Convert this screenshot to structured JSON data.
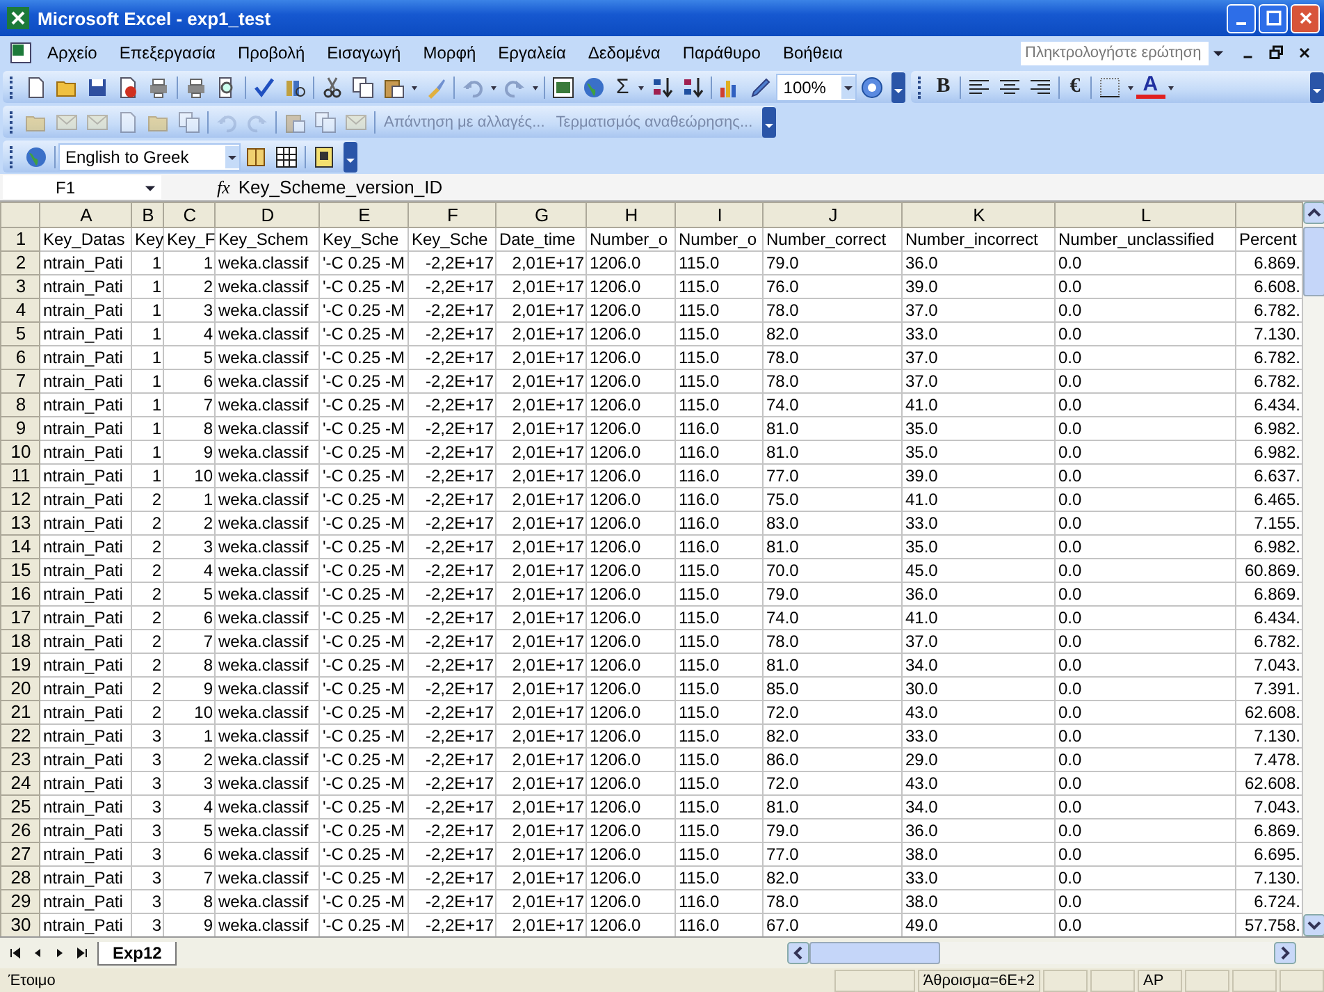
{
  "window": {
    "title": "Microsoft Excel - exp1_test"
  },
  "menu": [
    "Αρχείο",
    "Επεξεργασία",
    "Προβολή",
    "Εισαγωγή",
    "Μορφή",
    "Εργαλεία",
    "Δεδομένα",
    "Παράθυρο",
    "Βοήθεια"
  ],
  "help_box": {
    "placeholder": "Πληκτρολογήστε ερώτηση"
  },
  "standard_toolbar": {
    "autosum": "Σ",
    "zoom": "100%"
  },
  "formatting_toolbar": {
    "bold": "B",
    "currency": "€",
    "font_color": "A"
  },
  "reviewing_toolbar": {
    "disabled": true,
    "reply_with_changes": "Απάντηση με αλλαγές...",
    "end_review": "Τερματισμός αναθεώρησης..."
  },
  "translate_toolbar": {
    "language": "English to Greek"
  },
  "formula_bar": {
    "name_box": "F1",
    "fx": "fx",
    "formula": "Key_Scheme_version_ID"
  },
  "sheet": {
    "columns": [
      "A",
      "B",
      "C",
      "D",
      "E",
      "F",
      "G",
      "H",
      "I",
      "J",
      "K",
      "L"
    ],
    "rows": [
      {
        "number": "1",
        "cells": [
          "Key_Datas",
          "Key",
          "Key_F",
          "Key_Schem",
          "Key_Sche",
          "Key_Sche",
          "Date_time",
          "Number_o",
          "Number_o",
          "Number_correct",
          "Number_incorrect",
          "Number_unclassified",
          "Percent"
        ]
      },
      {
        "number": "2",
        "cells": [
          "ntrain_Pati",
          "1",
          "1",
          "weka.classif",
          "'-C 0.25 -M",
          "-2,2E+17",
          "2,01E+17",
          "1206.0",
          "115.0",
          "79.0",
          "36.0",
          "0.0",
          "6.869."
        ]
      },
      {
        "number": "3",
        "cells": [
          "ntrain_Pati",
          "1",
          "2",
          "weka.classif",
          "'-C 0.25 -M",
          "-2,2E+17",
          "2,01E+17",
          "1206.0",
          "115.0",
          "76.0",
          "39.0",
          "0.0",
          "6.608."
        ]
      },
      {
        "number": "4",
        "cells": [
          "ntrain_Pati",
          "1",
          "3",
          "weka.classif",
          "'-C 0.25 -M",
          "-2,2E+17",
          "2,01E+17",
          "1206.0",
          "115.0",
          "78.0",
          "37.0",
          "0.0",
          "6.782."
        ]
      },
      {
        "number": "5",
        "cells": [
          "ntrain_Pati",
          "1",
          "4",
          "weka.classif",
          "'-C 0.25 -M",
          "-2,2E+17",
          "2,01E+17",
          "1206.0",
          "115.0",
          "82.0",
          "33.0",
          "0.0",
          "7.130."
        ]
      },
      {
        "number": "6",
        "cells": [
          "ntrain_Pati",
          "1",
          "5",
          "weka.classif",
          "'-C 0.25 -M",
          "-2,2E+17",
          "2,01E+17",
          "1206.0",
          "115.0",
          "78.0",
          "37.0",
          "0.0",
          "6.782."
        ]
      },
      {
        "number": "7",
        "cells": [
          "ntrain_Pati",
          "1",
          "6",
          "weka.classif",
          "'-C 0.25 -M",
          "-2,2E+17",
          "2,01E+17",
          "1206.0",
          "115.0",
          "78.0",
          "37.0",
          "0.0",
          "6.782."
        ]
      },
      {
        "number": "8",
        "cells": [
          "ntrain_Pati",
          "1",
          "7",
          "weka.classif",
          "'-C 0.25 -M",
          "-2,2E+17",
          "2,01E+17",
          "1206.0",
          "115.0",
          "74.0",
          "41.0",
          "0.0",
          "6.434."
        ]
      },
      {
        "number": "9",
        "cells": [
          "ntrain_Pati",
          "1",
          "8",
          "weka.classif",
          "'-C 0.25 -M",
          "-2,2E+17",
          "2,01E+17",
          "1206.0",
          "116.0",
          "81.0",
          "35.0",
          "0.0",
          "6.982."
        ]
      },
      {
        "number": "10",
        "cells": [
          "ntrain_Pati",
          "1",
          "9",
          "weka.classif",
          "'-C 0.25 -M",
          "-2,2E+17",
          "2,01E+17",
          "1206.0",
          "116.0",
          "81.0",
          "35.0",
          "0.0",
          "6.982."
        ]
      },
      {
        "number": "11",
        "cells": [
          "ntrain_Pati",
          "1",
          "10",
          "weka.classif",
          "'-C 0.25 -M",
          "-2,2E+17",
          "2,01E+17",
          "1206.0",
          "116.0",
          "77.0",
          "39.0",
          "0.0",
          "6.637."
        ]
      },
      {
        "number": "12",
        "cells": [
          "ntrain_Pati",
          "2",
          "1",
          "weka.classif",
          "'-C 0.25 -M",
          "-2,2E+17",
          "2,01E+17",
          "1206.0",
          "116.0",
          "75.0",
          "41.0",
          "0.0",
          "6.465."
        ]
      },
      {
        "number": "13",
        "cells": [
          "ntrain_Pati",
          "2",
          "2",
          "weka.classif",
          "'-C 0.25 -M",
          "-2,2E+17",
          "2,01E+17",
          "1206.0",
          "116.0",
          "83.0",
          "33.0",
          "0.0",
          "7.155."
        ]
      },
      {
        "number": "14",
        "cells": [
          "ntrain_Pati",
          "2",
          "3",
          "weka.classif",
          "'-C 0.25 -M",
          "-2,2E+17",
          "2,01E+17",
          "1206.0",
          "116.0",
          "81.0",
          "35.0",
          "0.0",
          "6.982."
        ]
      },
      {
        "number": "15",
        "cells": [
          "ntrain_Pati",
          "2",
          "4",
          "weka.classif",
          "'-C 0.25 -M",
          "-2,2E+17",
          "2,01E+17",
          "1206.0",
          "115.0",
          "70.0",
          "45.0",
          "0.0",
          "60.869."
        ]
      },
      {
        "number": "16",
        "cells": [
          "ntrain_Pati",
          "2",
          "5",
          "weka.classif",
          "'-C 0.25 -M",
          "-2,2E+17",
          "2,01E+17",
          "1206.0",
          "115.0",
          "79.0",
          "36.0",
          "0.0",
          "6.869."
        ]
      },
      {
        "number": "17",
        "cells": [
          "ntrain_Pati",
          "2",
          "6",
          "weka.classif",
          "'-C 0.25 -M",
          "-2,2E+17",
          "2,01E+17",
          "1206.0",
          "115.0",
          "74.0",
          "41.0",
          "0.0",
          "6.434."
        ]
      },
      {
        "number": "18",
        "cells": [
          "ntrain_Pati",
          "2",
          "7",
          "weka.classif",
          "'-C 0.25 -M",
          "-2,2E+17",
          "2,01E+17",
          "1206.0",
          "115.0",
          "78.0",
          "37.0",
          "0.0",
          "6.782."
        ]
      },
      {
        "number": "19",
        "cells": [
          "ntrain_Pati",
          "2",
          "8",
          "weka.classif",
          "'-C 0.25 -M",
          "-2,2E+17",
          "2,01E+17",
          "1206.0",
          "115.0",
          "81.0",
          "34.0",
          "0.0",
          "7.043."
        ]
      },
      {
        "number": "20",
        "cells": [
          "ntrain_Pati",
          "2",
          "9",
          "weka.classif",
          "'-C 0.25 -M",
          "-2,2E+17",
          "2,01E+17",
          "1206.0",
          "115.0",
          "85.0",
          "30.0",
          "0.0",
          "7.391."
        ]
      },
      {
        "number": "21",
        "cells": [
          "ntrain_Pati",
          "2",
          "10",
          "weka.classif",
          "'-C 0.25 -M",
          "-2,2E+17",
          "2,01E+17",
          "1206.0",
          "115.0",
          "72.0",
          "43.0",
          "0.0",
          "62.608."
        ]
      },
      {
        "number": "22",
        "cells": [
          "ntrain_Pati",
          "3",
          "1",
          "weka.classif",
          "'-C 0.25 -M",
          "-2,2E+17",
          "2,01E+17",
          "1206.0",
          "115.0",
          "82.0",
          "33.0",
          "0.0",
          "7.130."
        ]
      },
      {
        "number": "23",
        "cells": [
          "ntrain_Pati",
          "3",
          "2",
          "weka.classif",
          "'-C 0.25 -M",
          "-2,2E+17",
          "2,01E+17",
          "1206.0",
          "115.0",
          "86.0",
          "29.0",
          "0.0",
          "7.478."
        ]
      },
      {
        "number": "24",
        "cells": [
          "ntrain_Pati",
          "3",
          "3",
          "weka.classif",
          "'-C 0.25 -M",
          "-2,2E+17",
          "2,01E+17",
          "1206.0",
          "115.0",
          "72.0",
          "43.0",
          "0.0",
          "62.608."
        ]
      },
      {
        "number": "25",
        "cells": [
          "ntrain_Pati",
          "3",
          "4",
          "weka.classif",
          "'-C 0.25 -M",
          "-2,2E+17",
          "2,01E+17",
          "1206.0",
          "115.0",
          "81.0",
          "34.0",
          "0.0",
          "7.043."
        ]
      },
      {
        "number": "26",
        "cells": [
          "ntrain_Pati",
          "3",
          "5",
          "weka.classif",
          "'-C 0.25 -M",
          "-2,2E+17",
          "2,01E+17",
          "1206.0",
          "115.0",
          "79.0",
          "36.0",
          "0.0",
          "6.869."
        ]
      },
      {
        "number": "27",
        "cells": [
          "ntrain_Pati",
          "3",
          "6",
          "weka.classif",
          "'-C 0.25 -M",
          "-2,2E+17",
          "2,01E+17",
          "1206.0",
          "115.0",
          "77.0",
          "38.0",
          "0.0",
          "6.695."
        ]
      },
      {
        "number": "28",
        "cells": [
          "ntrain_Pati",
          "3",
          "7",
          "weka.classif",
          "'-C 0.25 -M",
          "-2,2E+17",
          "2,01E+17",
          "1206.0",
          "115.0",
          "82.0",
          "33.0",
          "0.0",
          "7.130."
        ]
      },
      {
        "number": "29",
        "cells": [
          "ntrain_Pati",
          "3",
          "8",
          "weka.classif",
          "'-C 0.25 -M",
          "-2,2E+17",
          "2,01E+17",
          "1206.0",
          "116.0",
          "78.0",
          "38.0",
          "0.0",
          "6.724."
        ]
      },
      {
        "number": "30",
        "cells": [
          "ntrain_Pati",
          "3",
          "9",
          "weka.classif",
          "'-C 0.25 -M",
          "-2,2E+17",
          "2,01E+17",
          "1206.0",
          "116.0",
          "67.0",
          "49.0",
          "0.0",
          "57.758."
        ]
      }
    ]
  },
  "sheet_tabs": [
    {
      "label": "Exp12",
      "selected": true
    }
  ],
  "status_bar": {
    "status": "Έτοιμο",
    "sum": "Άθροισμα=6E+2",
    "mode": "AP"
  }
}
